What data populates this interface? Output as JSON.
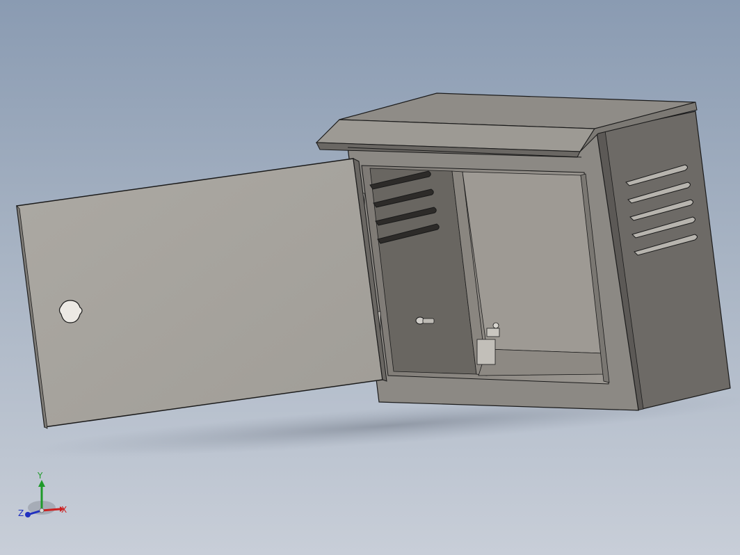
{
  "view": {
    "background_top": "#8a9bb2",
    "background_bottom": "#c8ced8"
  },
  "model": {
    "body_color": "#8b8883",
    "door_color": "#a8a59f",
    "side_color": "#6e6b67",
    "interior_color": "#8e8a84",
    "edge_color": "#1a1a1a"
  },
  "triad": {
    "x_label": "X",
    "y_label": "Y",
    "z_label": "Z",
    "x_color": "#cc2020",
    "y_color": "#1f9a2a",
    "z_color": "#2030c0"
  }
}
